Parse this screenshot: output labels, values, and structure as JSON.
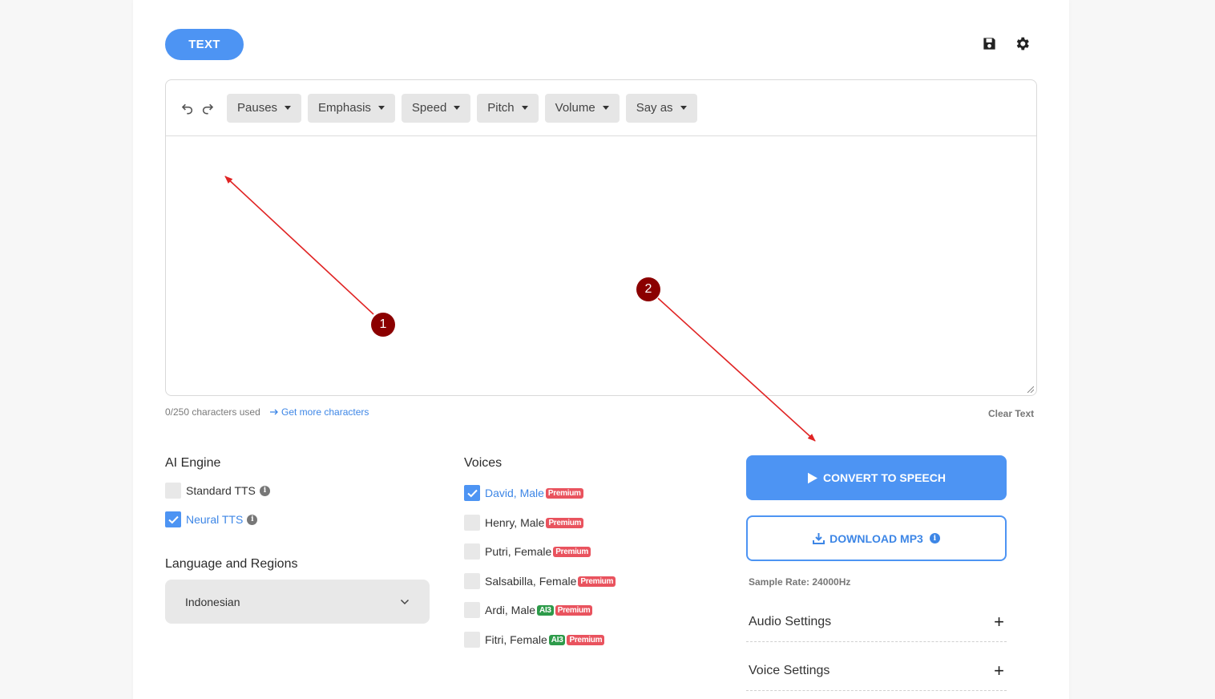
{
  "header": {
    "mode_label": "TEXT",
    "save_icon": "save-icon",
    "settings_icon": "gear-icon"
  },
  "toolbar": {
    "buttons": [
      {
        "label": "Pauses"
      },
      {
        "label": "Emphasis"
      },
      {
        "label": "Speed"
      },
      {
        "label": "Pitch"
      },
      {
        "label": "Volume"
      },
      {
        "label": "Say as"
      }
    ]
  },
  "editor": {
    "value": ""
  },
  "counter": {
    "used": "0/250 characters used",
    "more_link": "Get more characters",
    "clear": "Clear Text"
  },
  "engine": {
    "title": "AI Engine",
    "options": [
      {
        "label": "Standard TTS",
        "checked": false
      },
      {
        "label": "Neural TTS",
        "checked": true
      }
    ]
  },
  "language": {
    "title": "Language and Regions",
    "selected": "Indonesian"
  },
  "voices": {
    "title": "Voices",
    "items": [
      {
        "label": "David, Male",
        "ai3": "",
        "premium": "Premium",
        "checked": true
      },
      {
        "label": "Henry, Male",
        "ai3": "",
        "premium": "Premium",
        "checked": false
      },
      {
        "label": "Putri, Female",
        "ai3": "",
        "premium": "Premium",
        "checked": false
      },
      {
        "label": "Salsabilla, Female",
        "ai3": "",
        "premium": "Premium",
        "checked": false
      },
      {
        "label": "Ardi, Male",
        "ai3": "AI3",
        "premium": "Premium",
        "checked": false
      },
      {
        "label": "Fitri, Female",
        "ai3": "AI3",
        "premium": "Premium",
        "checked": false
      }
    ]
  },
  "actions": {
    "convert_label": "CONVERT TO SPEECH",
    "download_label": "DOWNLOAD MP3",
    "sample_rate": "Sample Rate: 24000Hz",
    "audio_settings": "Audio Settings",
    "voice_settings": "Voice Settings",
    "plus": "+"
  },
  "annotations": {
    "marker_1": "1",
    "marker_2": "2"
  },
  "colors": {
    "accent": "#4d94f3",
    "premium": "#e9535e",
    "ai3": "#2d9b4a",
    "marker": "#8b0000",
    "arrow": "#e02424"
  }
}
